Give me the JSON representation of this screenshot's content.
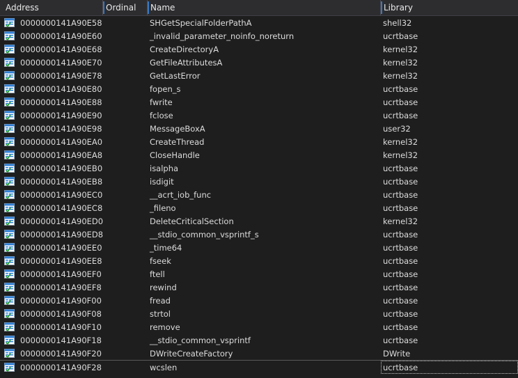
{
  "columns": {
    "address": "Address",
    "ordinal": "Ordinal",
    "name": "Name",
    "library": "Library"
  },
  "icon": "import-function-icon",
  "colors": {
    "background": "#1e1e1e",
    "header": "#2d2d30",
    "text": "#dcdcdc",
    "underline": "#d01616",
    "icon_blue": "#2f7fd6"
  },
  "rows": [
    {
      "address": "0000000141A90E58",
      "ordinal": "",
      "name": "SHGetSpecialFolderPathA",
      "library": "shell32"
    },
    {
      "address": "0000000141A90E60",
      "ordinal": "",
      "name": "_invalid_parameter_noinfo_noreturn",
      "library": "ucrtbase"
    },
    {
      "address": "0000000141A90E68",
      "ordinal": "",
      "name": "CreateDirectoryA",
      "library": "kernel32"
    },
    {
      "address": "0000000141A90E70",
      "ordinal": "",
      "name": "GetFileAttributesA",
      "library": "kernel32"
    },
    {
      "address": "0000000141A90E78",
      "ordinal": "",
      "name": "GetLastError",
      "library": "kernel32"
    },
    {
      "address": "0000000141A90E80",
      "ordinal": "",
      "name": "fopen_s",
      "library": "ucrtbase"
    },
    {
      "address": "0000000141A90E88",
      "ordinal": "",
      "name": "fwrite",
      "library": "ucrtbase"
    },
    {
      "address": "0000000141A90E90",
      "ordinal": "",
      "name": "fclose",
      "library": "ucrtbase"
    },
    {
      "address": "0000000141A90E98",
      "ordinal": "",
      "name": "MessageBoxA",
      "library": "user32"
    },
    {
      "address": "0000000141A90EA0",
      "ordinal": "",
      "name": "CreateThread",
      "library": "kernel32"
    },
    {
      "address": "0000000141A90EA8",
      "ordinal": "",
      "name": "CloseHandle",
      "library": "kernel32"
    },
    {
      "address": "0000000141A90EB0",
      "ordinal": "",
      "name": "isalpha",
      "library": "ucrtbase"
    },
    {
      "address": "0000000141A90EB8",
      "ordinal": "",
      "name": "isdigit",
      "library": "ucrtbase"
    },
    {
      "address": "0000000141A90EC0",
      "ordinal": "",
      "name": "__acrt_iob_func",
      "library": "ucrtbase"
    },
    {
      "address": "0000000141A90EC8",
      "ordinal": "",
      "name": "_fileno",
      "library": "ucrtbase"
    },
    {
      "address": "0000000141A90ED0",
      "ordinal": "",
      "name": "DeleteCriticalSection",
      "library": "kernel32"
    },
    {
      "address": "0000000141A90ED8",
      "ordinal": "",
      "name": "__stdio_common_vsprintf_s",
      "library": "ucrtbase"
    },
    {
      "address": "0000000141A90EE0",
      "ordinal": "",
      "name": "_time64",
      "library": "ucrtbase"
    },
    {
      "address": "0000000141A90EE8",
      "ordinal": "",
      "name": "fseek",
      "library": "ucrtbase"
    },
    {
      "address": "0000000141A90EF0",
      "ordinal": "",
      "name": "ftell",
      "library": "ucrtbase"
    },
    {
      "address": "0000000141A90EF8",
      "ordinal": "",
      "name": "rewind",
      "library": "ucrtbase"
    },
    {
      "address": "0000000141A90F00",
      "ordinal": "",
      "name": "fread",
      "library": "ucrtbase"
    },
    {
      "address": "0000000141A90F08",
      "ordinal": "",
      "name": "strtol",
      "library": "ucrtbase"
    },
    {
      "address": "0000000141A90F10",
      "ordinal": "",
      "name": "remove",
      "library": "ucrtbase"
    },
    {
      "address": "0000000141A90F18",
      "ordinal": "",
      "name": "__stdio_common_vsprintf",
      "library": "ucrtbase"
    },
    {
      "address": "0000000141A90F20",
      "ordinal": "",
      "name": "DWriteCreateFactory",
      "library": "DWrite"
    },
    {
      "address": "0000000141A90F28",
      "ordinal": "",
      "name": "wcslen",
      "library": "ucrtbase"
    }
  ]
}
